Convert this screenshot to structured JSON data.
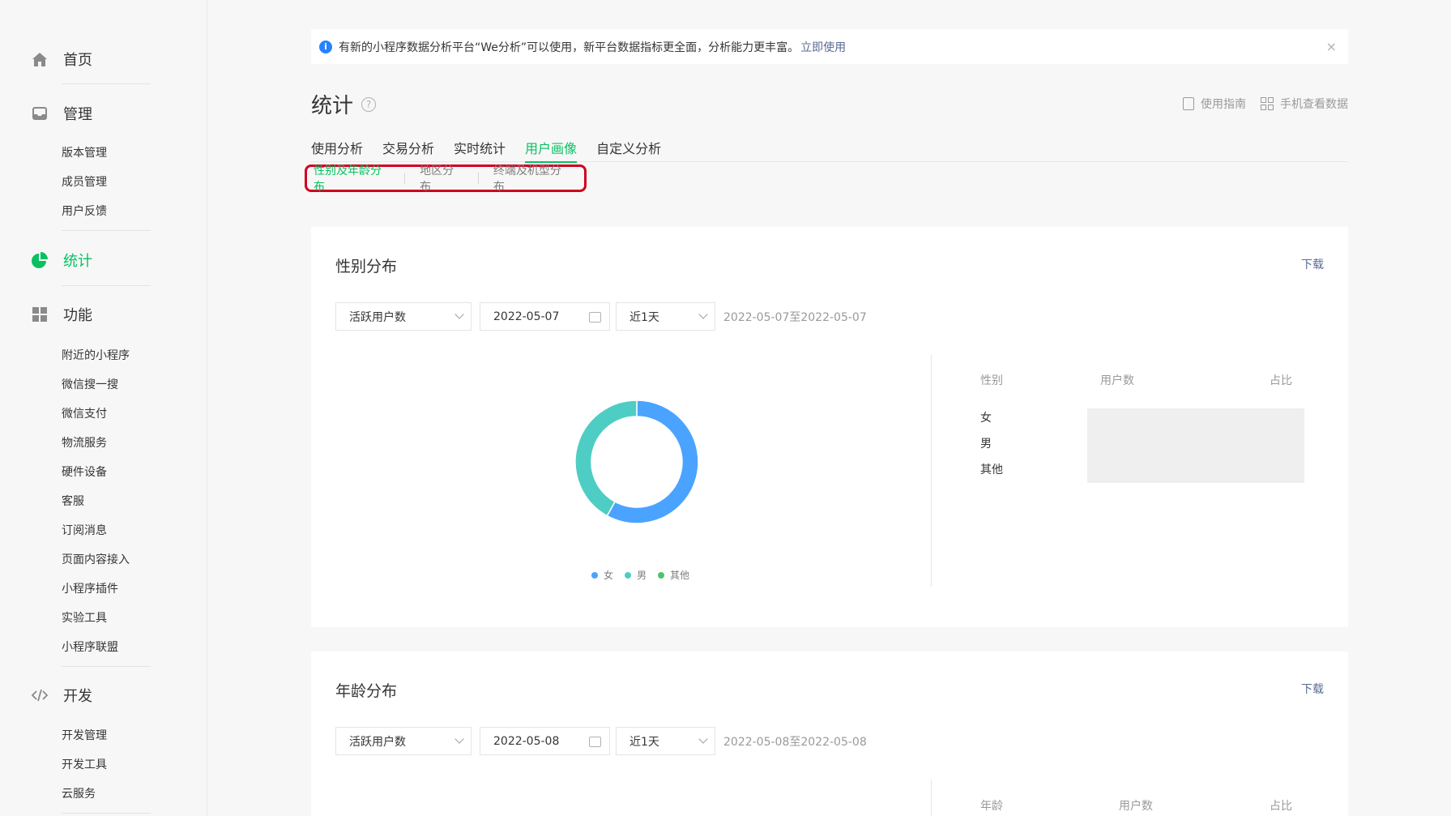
{
  "sidebar": {
    "home": "首页",
    "manage": "管理",
    "manage_items": [
      "版本管理",
      "成员管理",
      "用户反馈"
    ],
    "stats": "统计",
    "features": "功能",
    "feature_items": [
      "附近的小程序",
      "微信搜一搜",
      "微信支付",
      "物流服务",
      "硬件设备",
      "客服",
      "订阅消息",
      "页面内容接入",
      "小程序插件",
      "实验工具",
      "小程序联盟"
    ],
    "dev": "开发",
    "dev_items": [
      "开发管理",
      "开发工具",
      "云服务"
    ],
    "accent": "#07c160"
  },
  "notice": {
    "text": "有新的小程序数据分析平台“We分析”可以使用，新平台数据指标更全面，分析能力更丰富。",
    "link": "立即使用",
    "close": "×",
    "info": "i"
  },
  "page": {
    "title": "统计",
    "help": "?",
    "guide": "使用指南",
    "mobile": "手机查看数据"
  },
  "tabs": [
    "使用分析",
    "交易分析",
    "实时统计",
    "用户画像",
    "自定义分析"
  ],
  "subtabs": [
    "性别及年龄分布",
    "地区分布",
    "终端及机型分布"
  ],
  "gender_card": {
    "title": "性别分布",
    "download": "下载",
    "metric": "活跃用户数",
    "date": "2022-05-07",
    "period": "近1天",
    "range": "2022-05-07至2022-05-07",
    "headers": [
      "性别",
      "用户数",
      "占比"
    ],
    "rows": [
      "女",
      "男",
      "其他"
    ],
    "legend": [
      "女",
      "男",
      "其他"
    ],
    "colors": [
      "#4aa3ff",
      "#4ecdc4",
      "#4cc46b"
    ]
  },
  "age_card": {
    "title": "年龄分布",
    "download": "下载",
    "metric": "活跃用户数",
    "date": "2022-05-08",
    "period": "近1天",
    "range": "2022-05-08至2022-05-08",
    "headers": [
      "年龄",
      "用户数",
      "占比"
    ]
  },
  "chart_data": {
    "type": "pie",
    "categories": [
      "女",
      "男",
      "其他"
    ],
    "values": [
      58,
      42,
      0
    ],
    "legend": "bottom"
  }
}
